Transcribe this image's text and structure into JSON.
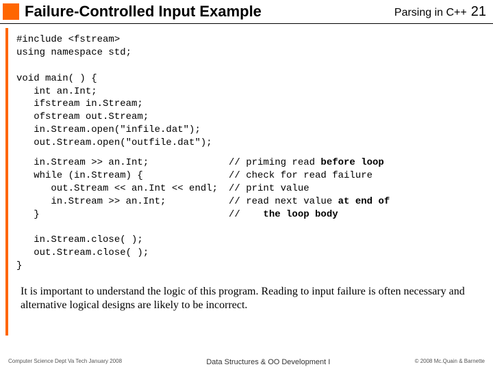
{
  "header": {
    "title": "Failure-Controlled Input Example",
    "section": "Parsing in C++",
    "page": "21"
  },
  "code": {
    "block1": "#include <fstream>\nusing namespace std;\n\nvoid main( ) {\n   int an.Int;\n   ifstream in.Stream;\n   ofstream out.Stream;\n   in.Stream.open(\"infile.dat\");\n   out.Stream.open(\"outfile.dat\");",
    "rows": [
      {
        "code": "   in.Stream >> an.Int;",
        "comment": "// priming read ",
        "bold": "before loop"
      },
      {
        "code": "",
        "comment": "",
        "bold": ""
      },
      {
        "code": "   while (in.Stream) {",
        "comment": "// check for read failure",
        "bold": ""
      },
      {
        "code": "      out.Stream << an.Int << endl;",
        "comment": "// print value",
        "bold": ""
      },
      {
        "code": "      in.Stream >> an.Int;",
        "comment": "// read next value ",
        "bold": "at end of"
      },
      {
        "code": "   }",
        "comment": "//    ",
        "bold": "the loop body"
      }
    ],
    "block2": "\n   in.Stream.close( );\n   out.Stream.close( );\n}"
  },
  "note": "It is important to understand the logic of this program.  Reading to input failure is often necessary and alternative logical designs are likely to be incorrect.",
  "footer": {
    "left": "Computer Science Dept Va Tech January 2008",
    "mid": "Data Structures & OO Development I",
    "right": "© 2008 Mc.Quain & Barnette"
  }
}
